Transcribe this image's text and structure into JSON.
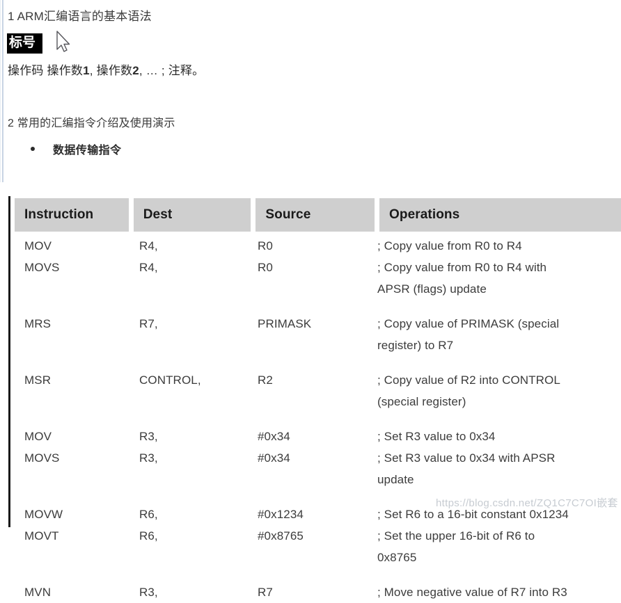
{
  "document": {
    "heading_1": "1 ARM汇编语言的基本语法",
    "label_highlight": "标号",
    "syntax_line": {
      "opcode": "操作码 操作数",
      "operand1_num": "1",
      "sep1": ", 操作数",
      "operand2_num": "2",
      "tail": ", … ; 注释。"
    },
    "heading_2": "2 常用的汇编指令介绍及使用演示",
    "bullet": {
      "icon": "bullet-dot",
      "text": "数据传输指令"
    },
    "watermark": "https://blog.csdn.net/ZQ1C7C7OI嵌套"
  },
  "table": {
    "columns": [
      "Instruction",
      "Dest",
      "Source",
      "Operations"
    ],
    "groups": [
      {
        "rows": [
          {
            "instruction": "MOV",
            "dest": "R4,",
            "source": "R0",
            "operations": "; Copy value from R0 to R4"
          },
          {
            "instruction": "MOVS",
            "dest": "R4,",
            "source": "R0",
            "operations": "; Copy value from R0 to R4 with\nAPSR (flags) update"
          }
        ]
      },
      {
        "rows": [
          {
            "instruction": "MRS",
            "dest": "R7,",
            "source": "PRIMASK",
            "operations": "; Copy value of PRIMASK (special\nregister) to R7"
          }
        ]
      },
      {
        "rows": [
          {
            "instruction": "MSR",
            "dest": "CONTROL,",
            "source": "R2",
            "operations": "; Copy value of R2 into CONTROL\n(special register)"
          }
        ]
      },
      {
        "rows": [
          {
            "instruction": "MOV",
            "dest": "R3,",
            "source": "#0x34",
            "operations": "; Set R3 value to 0x34"
          },
          {
            "instruction": "MOVS",
            "dest": "R3,",
            "source": "#0x34",
            "operations": "; Set R3 value to 0x34 with APSR\nupdate"
          }
        ]
      },
      {
        "rows": [
          {
            "instruction": "MOVW",
            "dest": "R6,",
            "source": "#0x1234",
            "operations": "; Set R6 to a 16-bit constant 0x1234"
          },
          {
            "instruction": "MOVT",
            "dest": "R6,",
            "source": "#0x8765",
            "operations": "; Set the upper 16-bit of R6 to\n0x8765"
          }
        ]
      },
      {
        "rows": [
          {
            "instruction": "MVN",
            "dest": "R3,",
            "source": "R7",
            "operations": "; Move negative value of R7 into R3"
          }
        ]
      }
    ]
  },
  "colors": {
    "header_bg": "#cfcfcf",
    "text": "#3c3c3c",
    "heading": "#3a3a3a",
    "highlight_bg": "#000000",
    "highlight_fg": "#ffffff",
    "left_rule": "#c8d4e4"
  }
}
